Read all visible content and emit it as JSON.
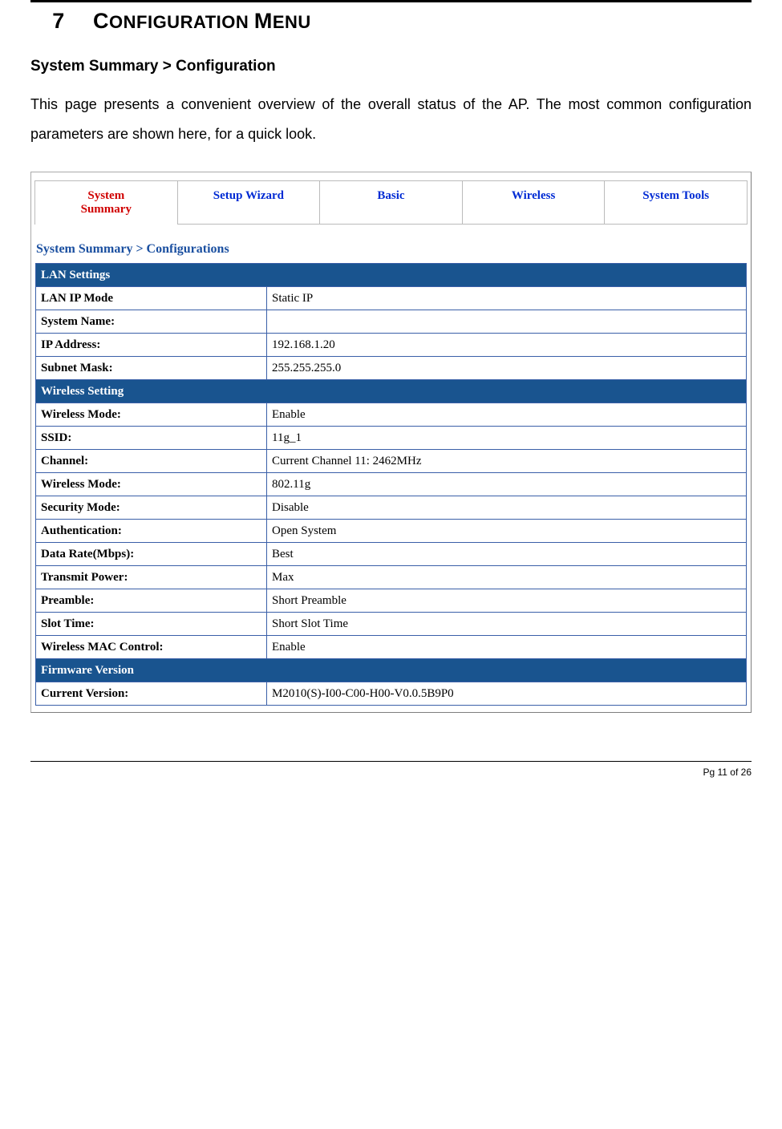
{
  "chapter": {
    "num": "7",
    "title_a": "C",
    "title_b": "ONFIGURATION ",
    "title_c": "M",
    "title_d": "ENU"
  },
  "breadcrumb": "System Summary > Configuration",
  "intro": "This page presents a convenient overview of the overall status of the AP. The most common configuration parameters are shown here, for a quick look.",
  "tabs": {
    "system_summary_a": "System",
    "system_summary_b": "Summary",
    "setup_wizard": "Setup Wizard",
    "basic": "Basic",
    "wireless": "Wireless",
    "system_tools": "System Tools"
  },
  "screenshot_breadcrumb": "System Summary > Configurations",
  "sections": {
    "lan_title": "LAN Settings",
    "lan_rows": [
      {
        "label": "LAN IP Mode",
        "value": "Static IP"
      },
      {
        "label": "System Name:",
        "value": ""
      },
      {
        "label": "IP Address:",
        "value": "192.168.1.20"
      },
      {
        "label": "Subnet Mask:",
        "value": "255.255.255.0"
      }
    ],
    "wl_title": "Wireless Setting",
    "wl_rows": [
      {
        "label": "Wireless Mode:",
        "value": "Enable"
      },
      {
        "label": "SSID:",
        "value": "11g_1"
      },
      {
        "label": "Channel:",
        "value": "Current Channel 11: 2462MHz"
      },
      {
        "label": "Wireless Mode:",
        "value": "802.11g"
      },
      {
        "label": "Security Mode:",
        "value": "Disable"
      },
      {
        "label": "Authentication:",
        "value": "Open System"
      },
      {
        "label": "Data Rate(Mbps):",
        "value": "Best"
      },
      {
        "label": "Transmit Power:",
        "value": "Max"
      },
      {
        "label": "Preamble:",
        "value": "Short Preamble"
      },
      {
        "label": "Slot Time:",
        "value": "Short Slot Time"
      },
      {
        "label": "Wireless MAC Control:",
        "value": "Enable"
      }
    ],
    "fw_title": "Firmware Version",
    "fw_rows": [
      {
        "label": "Current Version:",
        "value": "M2010(S)-I00-C00-H00-V0.0.5B9P0"
      }
    ]
  },
  "footer": "Pg 11 of 26"
}
